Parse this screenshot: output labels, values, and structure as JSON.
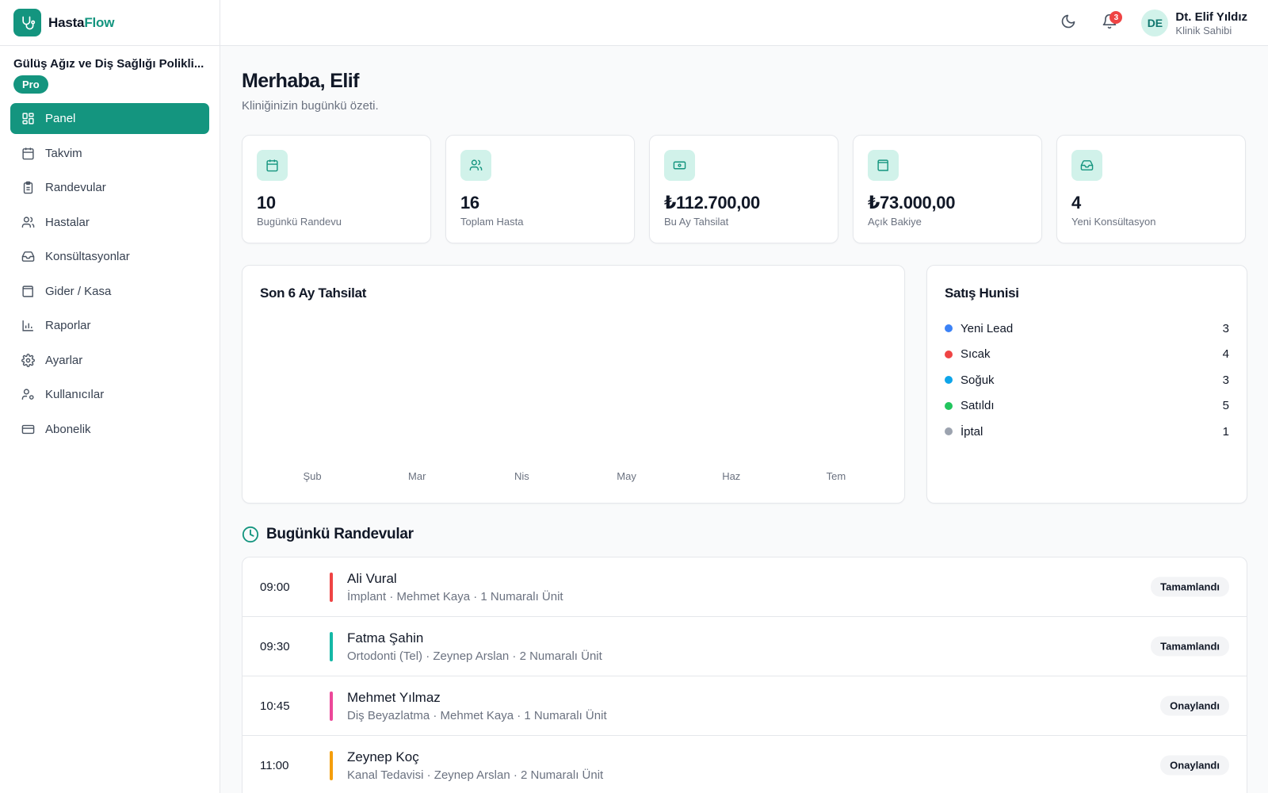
{
  "brand": {
    "name_part1": "Hasta",
    "name_part2": "Flow"
  },
  "clinic": {
    "name": "Gülüş Ağız ve Diş Sağlığı Polikli...",
    "plan": "Pro"
  },
  "nav": [
    {
      "label": "Panel",
      "icon": "grid-icon",
      "active": true
    },
    {
      "label": "Takvim",
      "icon": "calendar-icon"
    },
    {
      "label": "Randevular",
      "icon": "clipboard-icon"
    },
    {
      "label": "Hastalar",
      "icon": "users-icon"
    },
    {
      "label": "Konsültasyonlar",
      "icon": "inbox-icon"
    },
    {
      "label": "Gider / Kasa",
      "icon": "wallet-icon"
    },
    {
      "label": "Raporlar",
      "icon": "bar-chart-icon"
    },
    {
      "label": "Ayarlar",
      "icon": "gear-icon"
    },
    {
      "label": "Kullanıcılar",
      "icon": "user-cog-icon"
    },
    {
      "label": "Abonelik",
      "icon": "credit-card-icon"
    }
  ],
  "topbar": {
    "notification_count": "3",
    "avatar_initials": "DE",
    "user_name": "Dt. Elif Yıldız",
    "user_role": "Klinik Sahibi"
  },
  "header": {
    "greeting": "Merhaba, Elif",
    "subtitle": "Kliniğinizin bugünkü özeti."
  },
  "stats": [
    {
      "value": "10",
      "label": "Bugünkü Randevu",
      "icon": "calendar-icon"
    },
    {
      "value": "16",
      "label": "Toplam Hasta",
      "icon": "users-icon"
    },
    {
      "value": "₺112.700,00",
      "label": "Bu Ay Tahsilat",
      "icon": "banknote-icon"
    },
    {
      "value": "₺73.000,00",
      "label": "Açık Bakiye",
      "icon": "wallet-icon"
    },
    {
      "value": "4",
      "label": "Yeni Konsültasyon",
      "icon": "inbox-icon"
    }
  ],
  "chart_data": {
    "type": "bar",
    "title": "Son 6 Ay Tahsilat",
    "categories": [
      "Şub",
      "Mar",
      "Nis",
      "May",
      "Haz",
      "Tem"
    ],
    "values": [
      0,
      0,
      0,
      0,
      0,
      0
    ],
    "xlabel": "",
    "ylabel": "",
    "grid": false
  },
  "funnel": {
    "title": "Satış Hunisi",
    "items": [
      {
        "label": "Yeni Lead",
        "count": "3",
        "color": "#3b82f6"
      },
      {
        "label": "Sıcak",
        "count": "4",
        "color": "#ef4444"
      },
      {
        "label": "Soğuk",
        "count": "3",
        "color": "#0ea5e9"
      },
      {
        "label": "Satıldı",
        "count": "5",
        "color": "#22c55e"
      },
      {
        "label": "İptal",
        "count": "1",
        "color": "#9ca3af"
      }
    ]
  },
  "appointments": {
    "title": "Bugünkü Randevular",
    "items": [
      {
        "time": "09:00",
        "name": "Ali Vural",
        "detail": "İmplant · Mehmet Kaya · 1 Numaralı Ünit",
        "status": "Tamamlandı",
        "color": "#ef4444"
      },
      {
        "time": "09:30",
        "name": "Fatma Şahin",
        "detail": "Ortodonti (Tel) · Zeynep Arslan · 2 Numaralı Ünit",
        "status": "Tamamlandı",
        "color": "#14b8a6"
      },
      {
        "time": "10:45",
        "name": "Mehmet Yılmaz",
        "detail": "Diş Beyazlatma · Mehmet Kaya · 1 Numaralı Ünit",
        "status": "Onaylandı",
        "color": "#ec4899"
      },
      {
        "time": "11:00",
        "name": "Zeynep Koç",
        "detail": "Kanal Tedavisi · Zeynep Arslan · 2 Numaralı Ünit",
        "status": "Onaylandı",
        "color": "#f59e0b"
      }
    ]
  },
  "colors": {
    "accent": "#14957f",
    "accent_soft": "#d1f2ea"
  }
}
